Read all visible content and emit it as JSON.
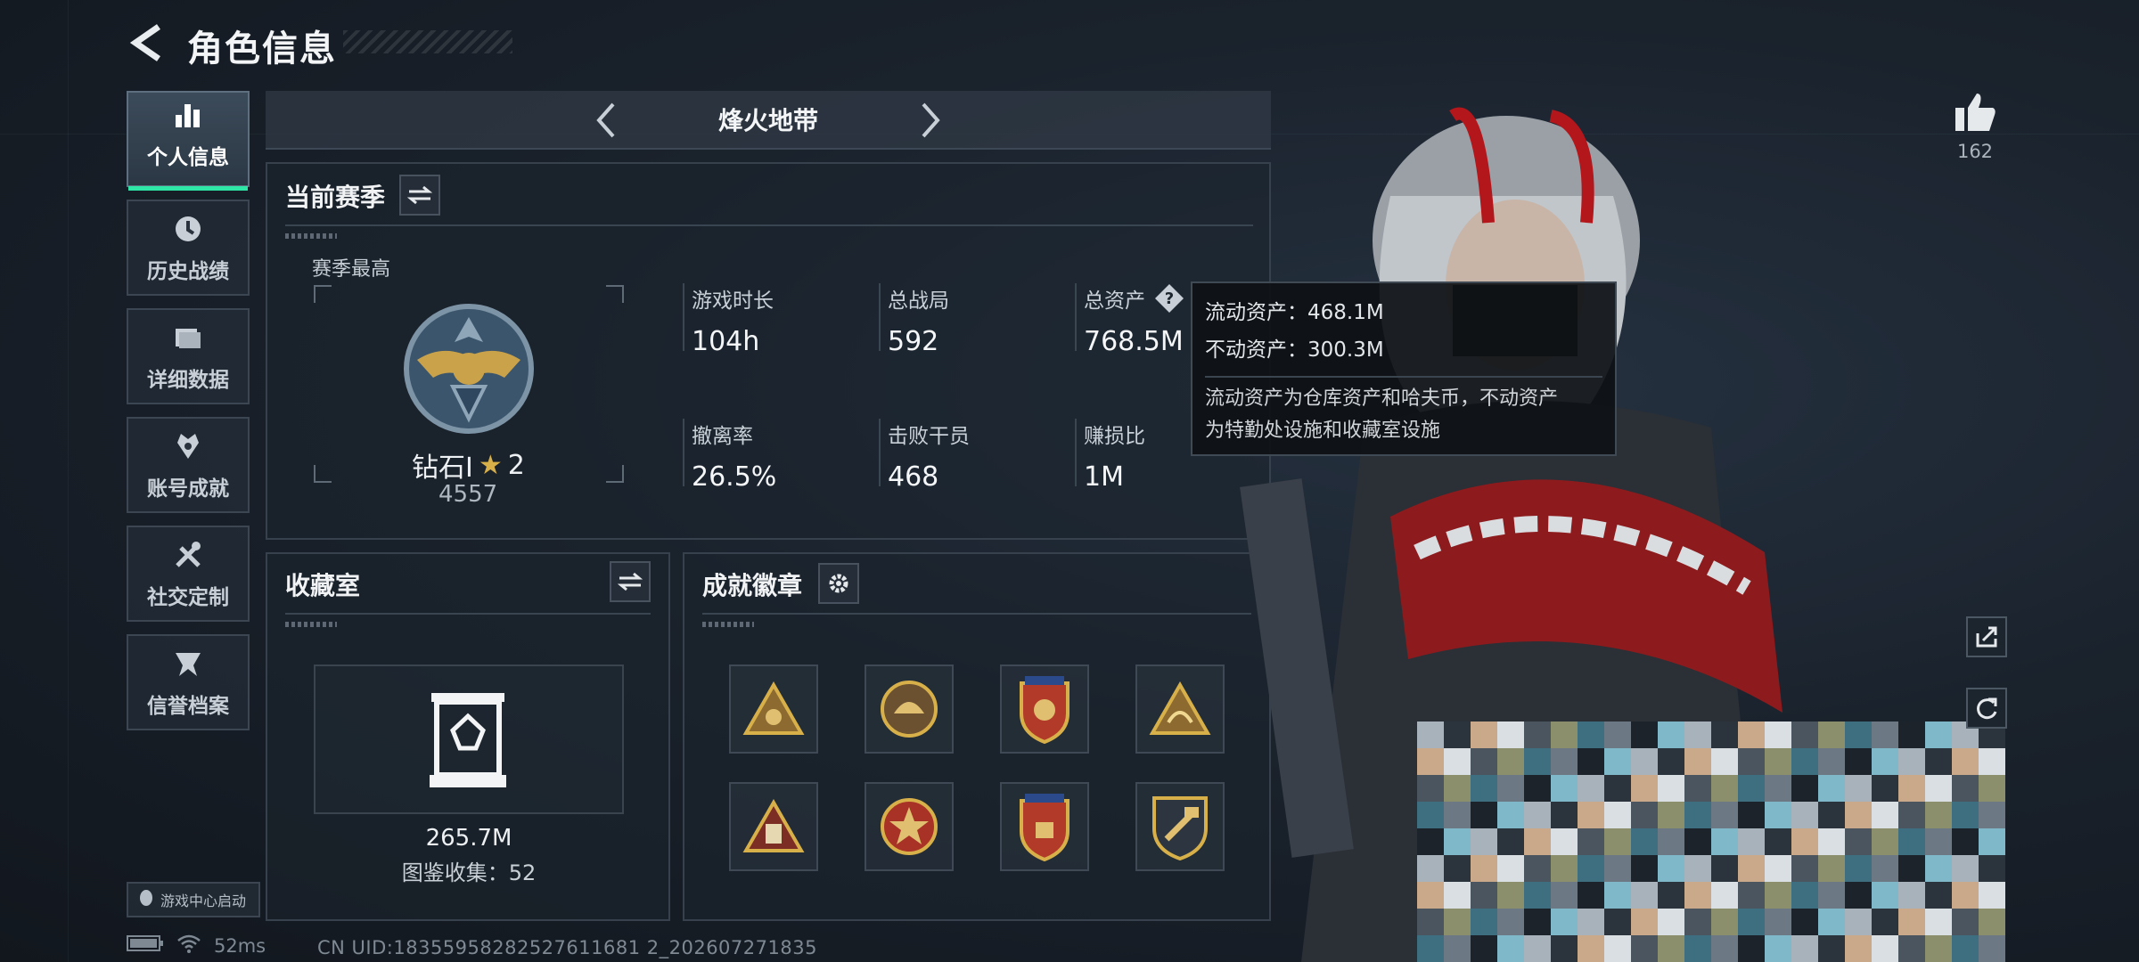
{
  "header": {
    "title": "角色信息"
  },
  "nav": {
    "items": [
      {
        "label": "个人信息",
        "icon": "bar-chart-icon",
        "active": true
      },
      {
        "label": "历史战绩",
        "icon": "clock-icon",
        "active": false
      },
      {
        "label": "详细数据",
        "icon": "folder-icon",
        "active": false
      },
      {
        "label": "账号成就",
        "icon": "achievement-icon",
        "active": false
      },
      {
        "label": "社交定制",
        "icon": "tools-icon",
        "active": false
      },
      {
        "label": "信誉档案",
        "icon": "credit-icon",
        "active": false
      }
    ],
    "launch_label": "游戏中心启动"
  },
  "mode": {
    "title": "烽火地带"
  },
  "season": {
    "title": "当前赛季",
    "best_label": "赛季最高",
    "rank_name": "钻石Ⅰ",
    "rank_stars": "2",
    "rank_score": "4557",
    "stats": [
      {
        "label": "游戏时长",
        "value": "104h"
      },
      {
        "label": "总战局",
        "value": "592"
      },
      {
        "label": "总资产",
        "value": "768.5M"
      },
      {
        "label": "撤离率",
        "value": "26.5%"
      },
      {
        "label": "击败干员",
        "value": "468"
      },
      {
        "label": "赚损比",
        "value": "1M"
      }
    ]
  },
  "tooltip": {
    "liquid": "流动资产：468.1M",
    "fixed": "不动资产：300.3M",
    "desc1": "流动资产为仓库资产和哈夫币，不动资产",
    "desc2": "为特勤处设施和收藏室设施"
  },
  "collection": {
    "title": "收藏室",
    "value": "265.7M",
    "count": "图鉴收集：52"
  },
  "badges": {
    "title": "成就徽章",
    "items": [
      "triangle-badge-icon",
      "helmet-badge-icon",
      "shield-badge-icon",
      "triangle-emblem-icon",
      "triangle-card-icon",
      "star-badge-icon",
      "shield-crest-icon",
      "shield-hammer-icon"
    ]
  },
  "social": {
    "like_count": "162"
  },
  "status": {
    "ping": "52ms",
    "uid": "CN UID:18355958282527611681 2_202607271835"
  },
  "colors": {
    "accent": "#2ee6a6",
    "gold": "#c9a24a",
    "panel": "#1c242e"
  }
}
